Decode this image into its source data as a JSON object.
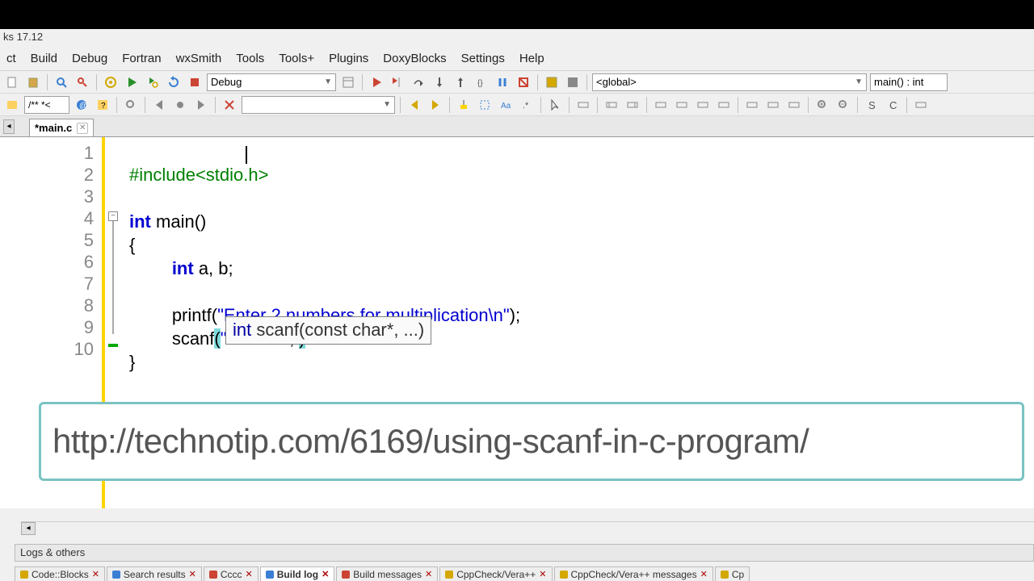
{
  "window": {
    "title_suffix": "ks 17.12"
  },
  "menubar": [
    "ct",
    "Build",
    "Debug",
    "Fortran",
    "wxSmith",
    "Tools",
    "Tools+",
    "Plugins",
    "DoxyBlocks",
    "Settings",
    "Help"
  ],
  "toolbar1": {
    "build_config": "Debug",
    "scope": "<global>",
    "func_scope": "main() : int"
  },
  "toolbar2": {
    "comment_field": "/**  *<"
  },
  "tab": {
    "name": "*main.c"
  },
  "code": {
    "lines": [
      "1",
      "2",
      "3",
      "4",
      "5",
      "6",
      "7",
      "8",
      "9",
      "10"
    ],
    "l1_a": "#include",
    "l1_b": "<stdio.h>",
    "l3_a": "int",
    "l3_b": " main()",
    "l4": "{",
    "l5_a": "int",
    "l5_b": " a, b;",
    "l7_a": "printf",
    "l7_b": "(",
    "l7_c": "\"Enter 2 numbers for multiplication\\n\"",
    "l7_d": ");",
    "l8_a": "scanf",
    "l8_p1": "(",
    "l8_s": "\"%d %d\"",
    "l8_c": ", ",
    "l8_p2": ")",
    "l9": "}",
    "tooltip_a": "int ",
    "tooltip_b": "scanf(const char*, ...)"
  },
  "overlay": {
    "url": "http://technotip.com/6169/using-scanf-in-c-program/"
  },
  "logs": {
    "title": "Logs & others"
  },
  "bottom_tabs": [
    {
      "label": "Code::Blocks",
      "active": false,
      "ico": "ico-yellow"
    },
    {
      "label": "Search results",
      "active": false,
      "ico": "ico-blue"
    },
    {
      "label": "Cccc",
      "active": false,
      "ico": "ico-red"
    },
    {
      "label": "Build log",
      "active": true,
      "ico": "ico-blue"
    },
    {
      "label": "Build messages",
      "active": false,
      "ico": "ico-red"
    },
    {
      "label": "CppCheck/Vera++",
      "active": false,
      "ico": "ico-yellow"
    },
    {
      "label": "CppCheck/Vera++ messages",
      "active": false,
      "ico": "ico-yellow"
    },
    {
      "label": "Cp",
      "active": false,
      "ico": "ico-yellow"
    }
  ]
}
